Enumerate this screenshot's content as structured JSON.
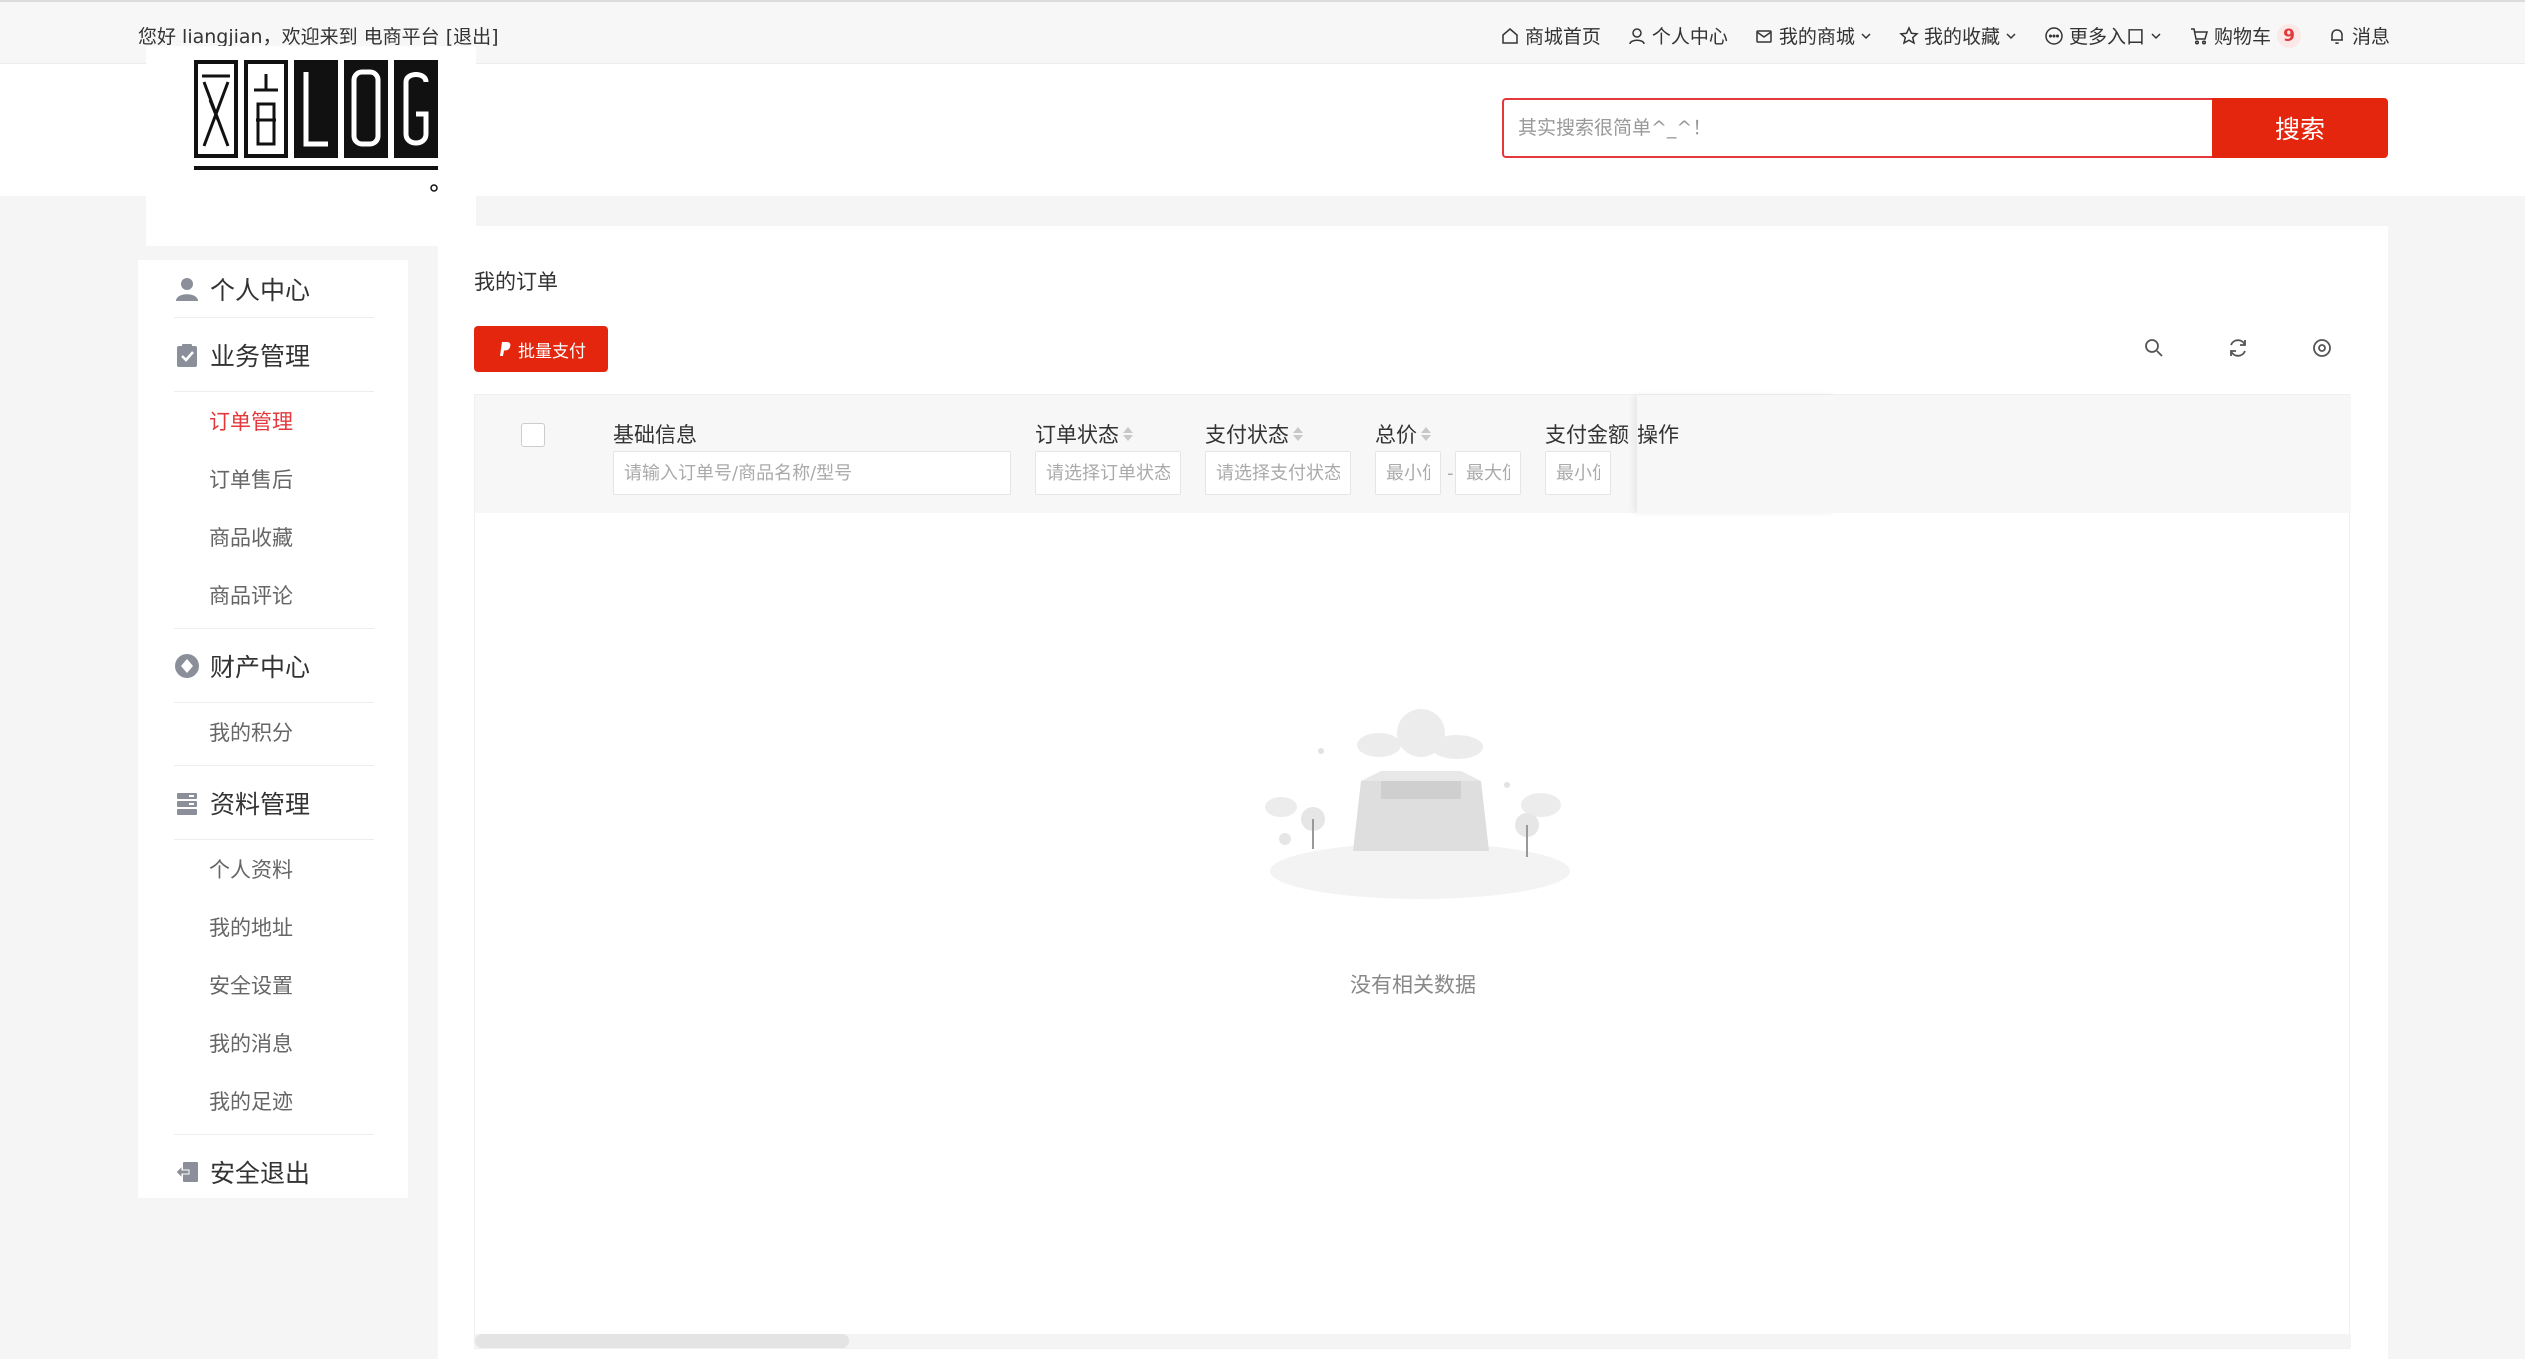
{
  "topbar": {
    "greeting": "您好 liangjian，欢迎来到 电商平台",
    "logout": "[退出]",
    "nav": [
      {
        "label": "商城首页",
        "icon": "home-icon"
      },
      {
        "label": "个人中心",
        "icon": "user-icon"
      },
      {
        "label": "我的商城",
        "icon": "mail-icon",
        "dropdown": true
      },
      {
        "label": "我的收藏",
        "icon": "star-icon",
        "dropdown": true
      },
      {
        "label": "更多入口",
        "icon": "more-icon",
        "dropdown": true
      },
      {
        "label": "购物车",
        "icon": "cart-icon",
        "badge": "9"
      },
      {
        "label": "消息",
        "icon": "bell-icon"
      }
    ]
  },
  "search": {
    "placeholder": "其实搜索很简单^_^！",
    "button": "搜索"
  },
  "sidebar": {
    "groups": [
      {
        "title": "个人中心",
        "icon": "user-icon",
        "items": []
      },
      {
        "title": "业务管理",
        "icon": "clipboard-icon",
        "items": [
          "订单管理",
          "订单售后",
          "商品收藏",
          "商品评论"
        ],
        "active": "订单管理"
      },
      {
        "title": "财产中心",
        "icon": "diamond-icon",
        "items": [
          "我的积分"
        ]
      },
      {
        "title": "资料管理",
        "icon": "database-icon",
        "items": [
          "个人资料",
          "我的地址",
          "安全设置",
          "我的消息",
          "我的足迹"
        ]
      },
      {
        "title": "安全退出",
        "icon": "logout-icon",
        "items": []
      }
    ]
  },
  "main": {
    "title": "我的订单",
    "batch_pay": "批量支付",
    "columns": {
      "basic": "基础信息",
      "order_status": "订单状态",
      "pay_status": "支付状态",
      "total": "总价",
      "pay_amount": "支付金额",
      "operation": "操作"
    },
    "filters": {
      "basic": "请输入订单号/商品名称/型号",
      "order_status": "请选择订单状态",
      "pay_status": "请选择支付状态",
      "min": "最小值",
      "max": "最大值",
      "range_sep": "-"
    },
    "empty_text": "没有相关数据"
  },
  "colors": {
    "accent": "#e4260e",
    "active_text": "#e4393c"
  }
}
